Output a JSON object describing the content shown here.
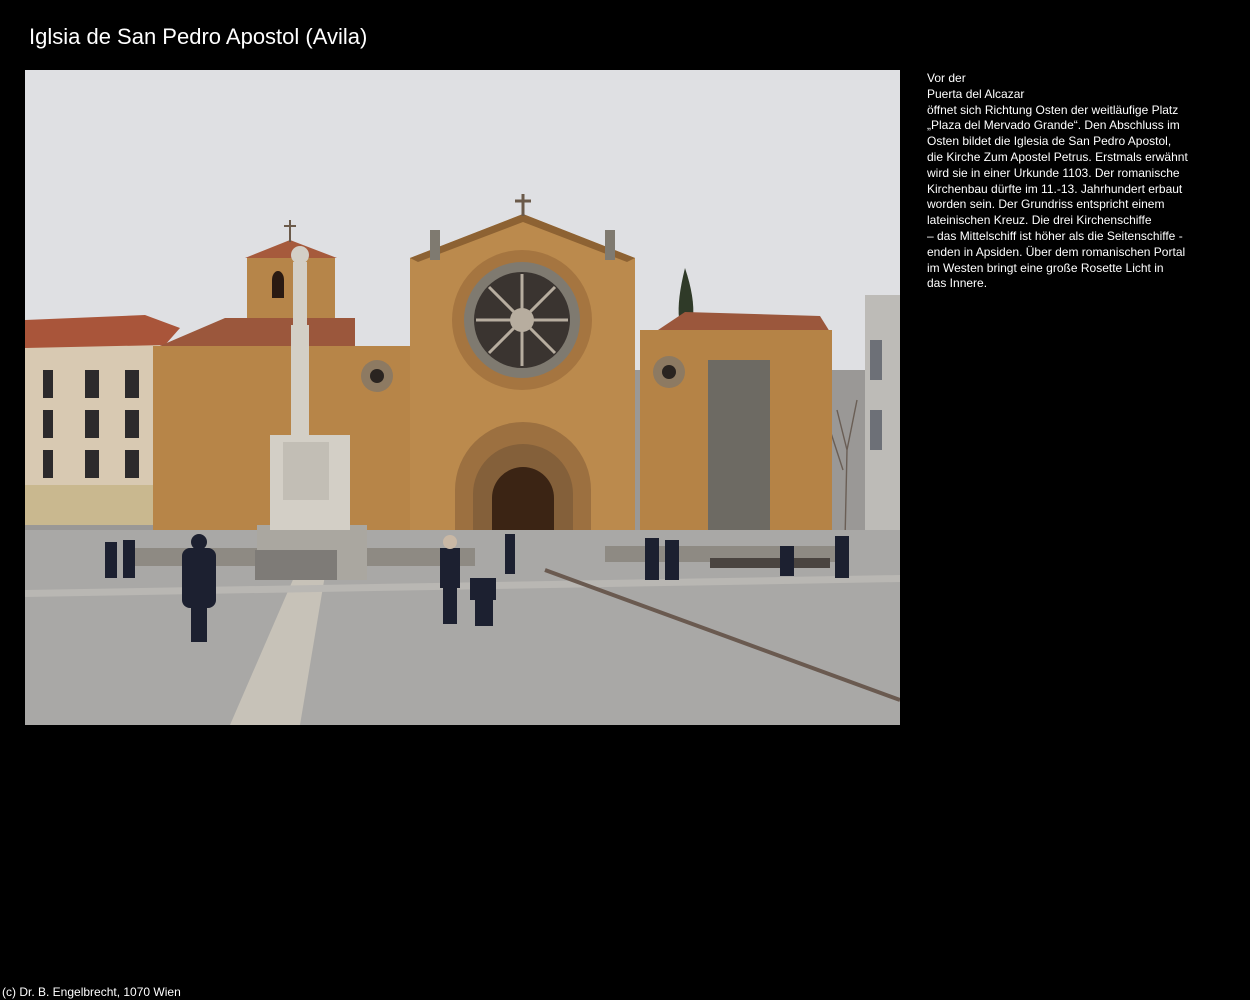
{
  "page": {
    "title": "Iglsia de San Pedro Apostol (Avila)"
  },
  "photo": {
    "subject": "church-facade-photo",
    "colors": {
      "sky": "#dcdde0",
      "stone": "#b98a4e",
      "stone_dark": "#8d6233",
      "roof": "#a65a3c",
      "plaza": "#a9a8a6",
      "door": "#3b2414",
      "granite": "#6d6a63"
    }
  },
  "description": {
    "lines": [
      "Vor der",
      "Puerta del Alcazar",
      "öffnet sich Richtung Osten der weitläufige Platz",
      "„Plaza del Mervado Grande“. Den Abschluss im",
      "Osten bildet die Iglesia de San Pedro Apostol,",
      "die Kirche Zum Apostel Petrus. Erstmals erwähnt",
      "wird sie in einer Urkunde 1103. Der romanische",
      "Kirchenbau dürfte im 11.-13. Jahrhundert erbaut",
      "worden sein. Der Grundriss entspricht einem",
      "lateinischen Kreuz. Die drei Kirchenschiffe",
      "– das Mittelschiff ist höher als die Seitenschiffe -",
      "enden in Apsiden. Über dem romanischen Portal",
      "im Westen bringt eine große Rosette Licht in",
      "das Innere."
    ]
  },
  "footer": {
    "copyright": "(c) Dr. B. Engelbrecht, 1070 Wien"
  }
}
